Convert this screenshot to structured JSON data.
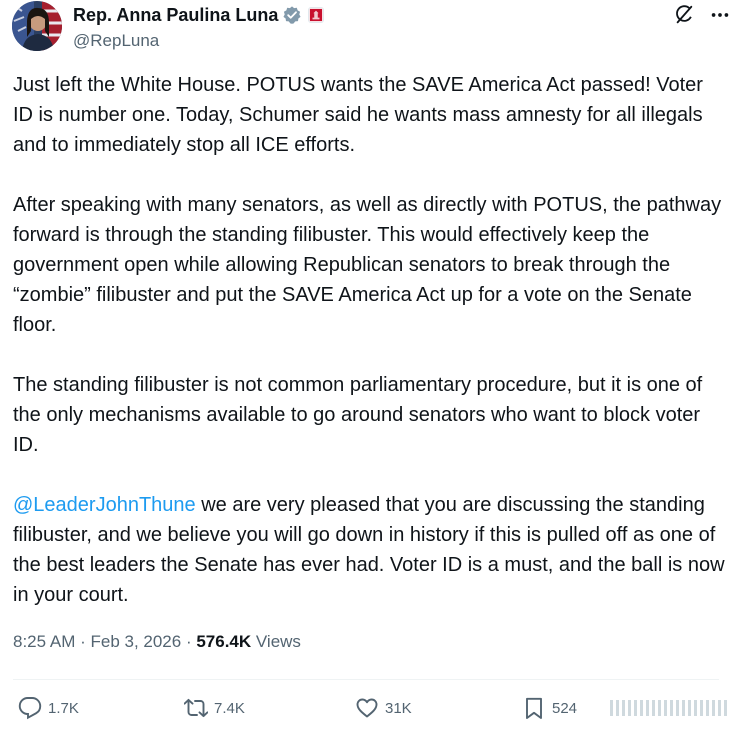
{
  "author": {
    "name": "Rep. Anna Paulina Luna",
    "handle": "@RepLuna",
    "avatar_icon": "avatar-portrait",
    "verified_icon": "verified-badge-icon",
    "affiliation_icon": "congress-affiliation-icon"
  },
  "tweet": {
    "paragraph1": "Just left the White House. POTUS wants the SAVE America Act passed! Voter ID is number one. Today, Schumer said he wants mass amnesty for all illegals and to immediately stop all ICE efforts.",
    "paragraph2": "After speaking with many senators, as well as directly with POTUS, the pathway forward is through the standing filibuster. This would effectively keep the government open while allowing Republican senators to break through the “zombie” filibuster and put the SAVE America Act up for a vote on the Senate floor.",
    "paragraph3": "The standing filibuster is not common parliamentary procedure, but it is one of the only mechanisms available to go around senators who want to block voter ID.",
    "mention": "@LeaderJohnThune",
    "paragraph4_rest": " we are very pleased that you are discussing the standing filibuster, and we believe you will go down in history if this is pulled off as one of the best leaders the Senate has ever had. Voter ID is a must, and the ball is now in your court."
  },
  "meta": {
    "time": "8:25 AM",
    "separator": " · ",
    "date": "Feb 3, 2026",
    "views_count": "576.4K",
    "views_label": " Views"
  },
  "actions": {
    "replies": "1.7K",
    "reposts": "7.4K",
    "likes": "31K",
    "bookmarks": "524"
  },
  "colors": {
    "text": "#0f1419",
    "secondary": "#536471",
    "link": "#1d9bf0",
    "verified": "#829aab",
    "affiliation": "#c8102e"
  }
}
